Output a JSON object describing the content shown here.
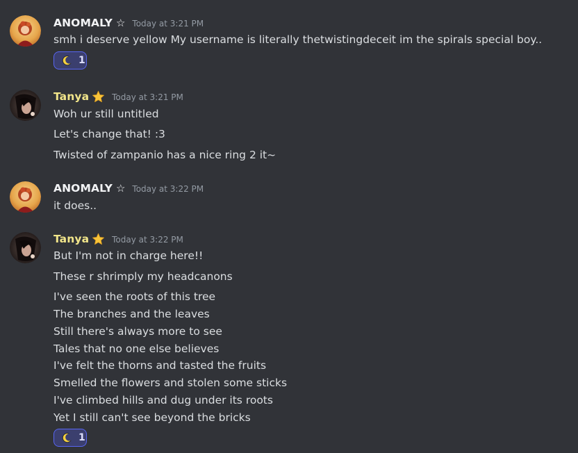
{
  "messages": [
    {
      "author": "ANOMALY",
      "badge": "☆",
      "timestamp": "Today at 3:21 PM",
      "lines": [
        "smh i deserve yellow My username is literally thetwistingdeceit im the spirals special boy.."
      ],
      "reaction": {
        "emoji": "crescent-moon",
        "count": "1"
      }
    },
    {
      "author": "Tanya",
      "badge": "star-emoji",
      "timestamp": "Today at 3:21 PM",
      "lines": [
        "Woh ur still untitled",
        "Let's change that! :3",
        "Twisted of zampanio has a nice ring 2 it~"
      ]
    },
    {
      "author": "ANOMALY",
      "badge": "☆",
      "timestamp": "Today at 3:22 PM",
      "lines": [
        "it does.."
      ]
    },
    {
      "author": "Tanya",
      "badge": "star-emoji",
      "timestamp": "Today at 3:22 PM",
      "lines": [
        "But I'm not in charge here!!",
        "These r shrimply my headcanons",
        "I've seen the roots of this tree",
        "The branches and the leaves",
        "Still there's always more to see",
        "Tales that no one else believes",
        "I've felt the thorns and tasted the fruits",
        "Smelled the flowers and stolen some sticks",
        "I've climbed hills and dug under its roots",
        "Yet I still can't see beyond the bricks"
      ],
      "reaction": {
        "emoji": "crescent-moon",
        "count": "1"
      }
    }
  ],
  "colors": {
    "background": "#313338",
    "anomaly_name": "#f2f3f5",
    "tanya_name": "#f1e58a",
    "timestamp": "#949ba4",
    "message_text": "#dbdee1",
    "reaction_border": "#5865f2",
    "reaction_bg": "#3b3f6e"
  }
}
